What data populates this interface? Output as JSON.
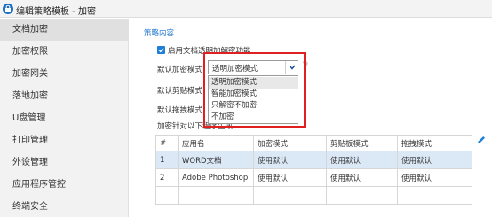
{
  "window": {
    "title": "编辑策略模板 - 加密"
  },
  "sidebar": {
    "items": [
      {
        "label": "文档加密",
        "active": true
      },
      {
        "label": "加密权限"
      },
      {
        "label": "加密网关"
      },
      {
        "label": "落地加密"
      },
      {
        "label": "U盘管理"
      },
      {
        "label": "打印管理"
      },
      {
        "label": "外设管理"
      },
      {
        "label": "应用程序管控"
      },
      {
        "label": "终端安全"
      }
    ]
  },
  "main": {
    "section_title": "策略内容",
    "enable_label": "启用文档透明加解密功能",
    "enable_checked": true,
    "encrypt_mode_label": "默认加密模式",
    "encrypt_mode_value": "透明加密模式",
    "clipboard_label": "默认剪贴模式",
    "drag_label": "默认拖拽模式",
    "apps_label": "加密针对以下程序生效",
    "dropdown_options": [
      {
        "label": "透明加密模式",
        "selected": true
      },
      {
        "label": "智能加密模式"
      },
      {
        "label": "只解密不加密"
      },
      {
        "label": "不加密"
      }
    ],
    "highlight_color": "#e02020",
    "accent_color": "#2c7cd1"
  },
  "table": {
    "headers": [
      "#",
      "应用名",
      "加密模式",
      "剪贴板模式",
      "拖拽模式"
    ],
    "rows": [
      [
        "1",
        "WORD文档",
        "使用默认",
        "使用默认",
        "使用默认"
      ],
      [
        "2",
        "Adobe Photoshop",
        "使用默认",
        "使用默认",
        "使用默认"
      ]
    ]
  },
  "icons": [
    "app-icon",
    "checkmark-icon",
    "chevron-down-icon",
    "help-icon",
    "edit-pencil-icon"
  ]
}
